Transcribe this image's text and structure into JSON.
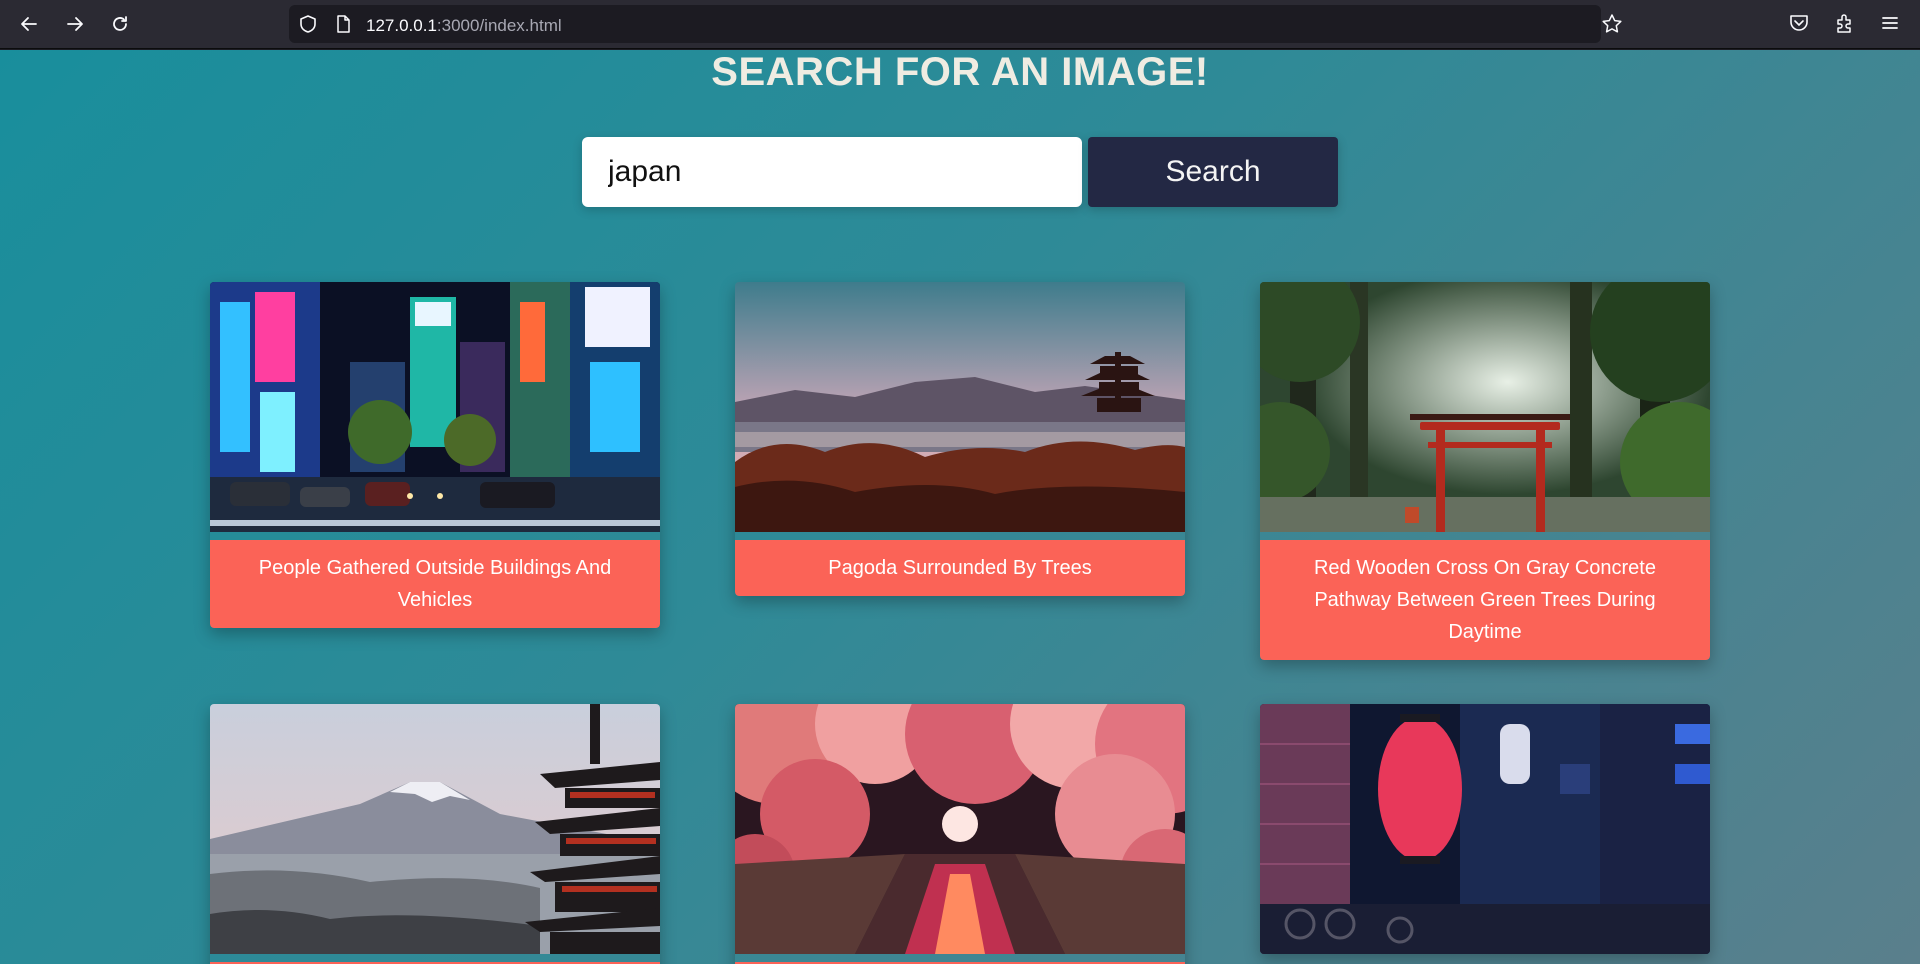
{
  "browser": {
    "url_host": "127.0.0.1",
    "url_rest": ":3000/index.html",
    "icons": [
      "back-icon",
      "forward-icon",
      "reload-icon",
      "shield-icon",
      "page-icon",
      "bookmark-star-icon",
      "pocket-icon",
      "extensions-icon",
      "menu-icon"
    ]
  },
  "page": {
    "title": "SEARCH FOR AN IMAGE!",
    "search": {
      "value": "japan",
      "placeholder": ""
    },
    "search_button_label": "Search"
  },
  "results": [
    {
      "caption": "People Gathered Outside Buildings And Vehicles",
      "scene": "neon city street at night"
    },
    {
      "caption": "Pagoda Surrounded By Trees",
      "scene": "pagoda over city at dusk"
    },
    {
      "caption": "Red Wooden Cross On Gray Concrete Pathway Between Green Trees During Daytime",
      "scene": "torii gate in forest"
    },
    {
      "caption": "",
      "scene": "mount fuji and pagoda"
    },
    {
      "caption": "",
      "scene": "cherry blossom canal"
    },
    {
      "caption": "",
      "scene": "alley with red lantern at night"
    }
  ],
  "colors": {
    "accent": "#fb6357",
    "button": "#232844",
    "bg_start": "#198e9c",
    "bg_end": "#5a7f8c"
  }
}
